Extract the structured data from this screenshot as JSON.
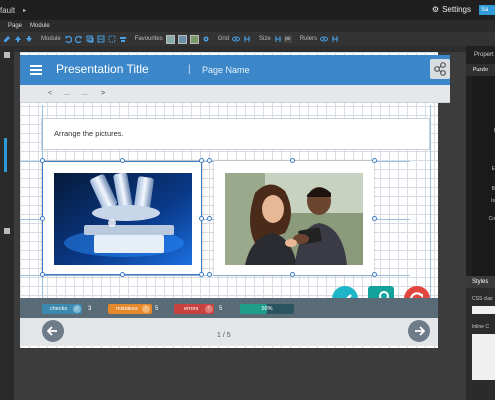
{
  "topbar": {
    "project": "fault",
    "settings_label": "Settings",
    "save_label": "Sa"
  },
  "menu": {
    "page_label": "Page",
    "module_label": "Module"
  },
  "toolbar": {
    "module_label": "Module",
    "favourites_label": "Favourites",
    "grid_label": "Grid",
    "size_label": "Size",
    "size_unit": "px",
    "rulers_label": "Rulers"
  },
  "right_panel": {
    "title": "Propert",
    "tab_label": "Puzzle",
    "styles_title": "Styles",
    "css_class_label": "CSS clas",
    "inline_label": "Inline C"
  },
  "presentation": {
    "title": "Presentation Title",
    "separator": "|",
    "page_name": "Page Name",
    "breadcrumb_back": "<",
    "breadcrumb_dots1": "...",
    "breadcrumb_dots2": "...",
    "breadcrumb_next": ">",
    "instruction": "Arrange the pictures.",
    "page_indicator": "1 / 5"
  },
  "status": {
    "checks_label": "checks",
    "checks_count": "3",
    "mistakes_label": "mistakes",
    "mistakes_count": "5",
    "errors_label": "errors",
    "errors_count": "5",
    "progress_label": "50%",
    "progress": 0.5
  },
  "colors": {
    "header": "#3b87c9",
    "check_btn": "#1fb5c9",
    "key_btn": "#12a39c",
    "reset_btn": "#e2453d",
    "checks": "#3d8ab0",
    "mistakes": "#e5892b",
    "errors": "#c8423f",
    "progress": "#1f9e8c"
  }
}
